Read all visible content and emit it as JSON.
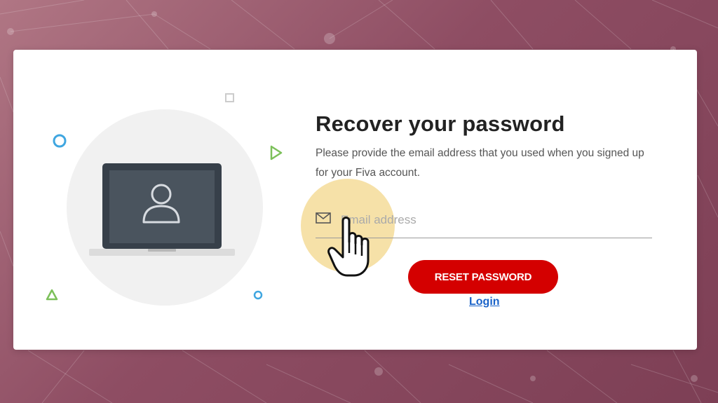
{
  "recover": {
    "title": "Recover your password",
    "description": "Please provide the email address that you used when you signed up for your Fiva account.",
    "email_placeholder": "Email address",
    "email_value": "",
    "reset_label": "RESET PASSWORD",
    "login_label": "Login"
  },
  "icons": {
    "email": "mail-icon",
    "user": "user-icon",
    "laptop": "laptop-icon",
    "pointer": "hand-pointer-icon"
  },
  "colors": {
    "primary_button": "#d40000",
    "link": "#1a63c9",
    "background": "#8e4d63",
    "highlight": "#f0cd6e",
    "laptop_screen": "#4a545e"
  }
}
